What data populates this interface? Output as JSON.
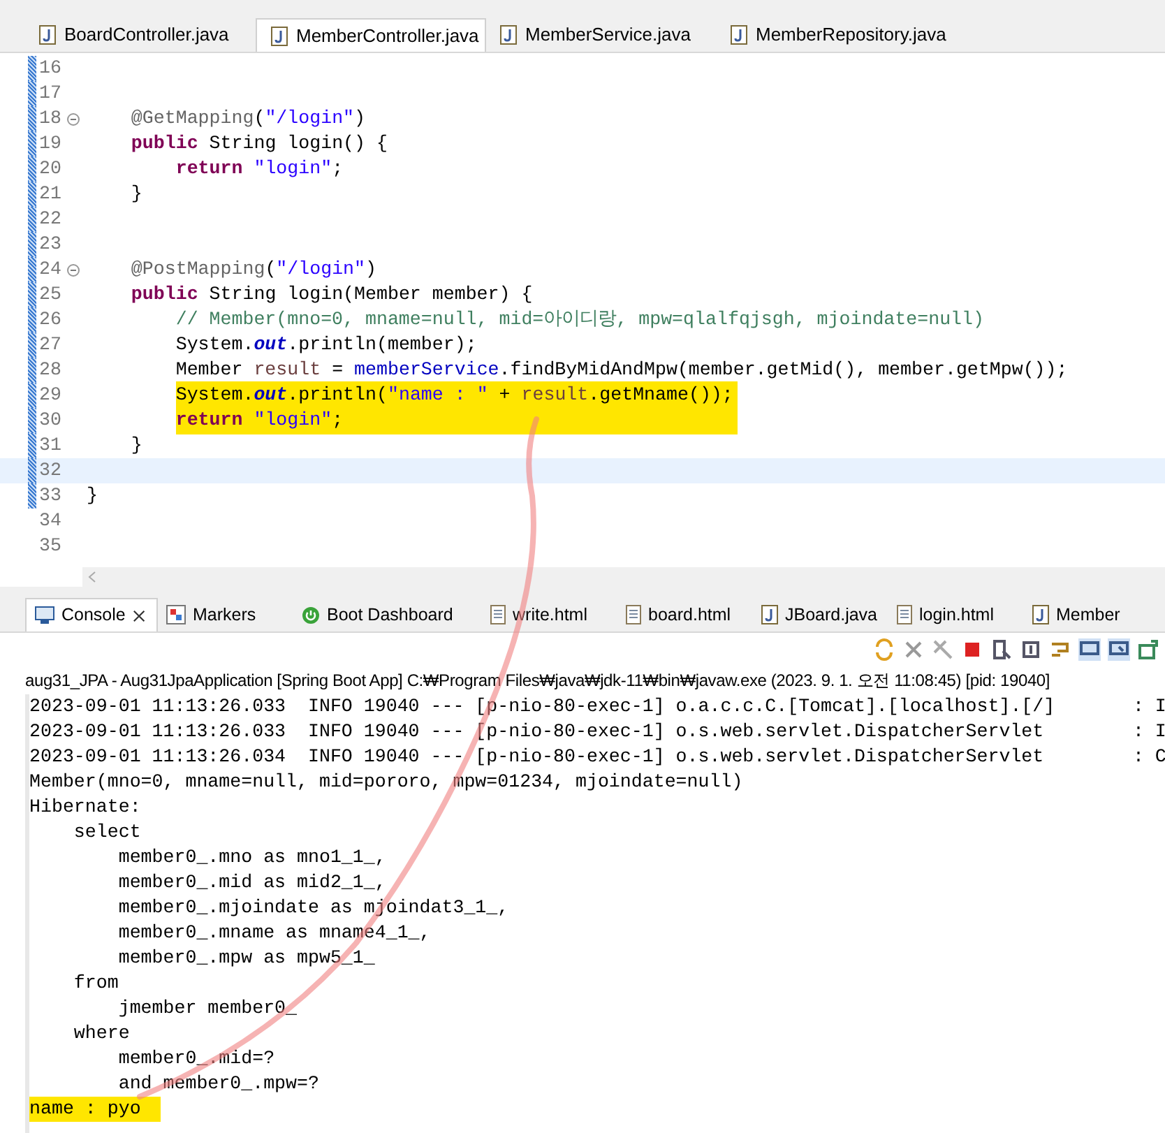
{
  "editor_tabs": [
    {
      "label": "BoardController.java",
      "selected": false
    },
    {
      "label": "MemberController.java",
      "selected": true
    },
    {
      "label": "MemberService.java",
      "selected": false
    },
    {
      "label": "MemberRepository.java",
      "selected": false
    }
  ],
  "code_lines": [
    {
      "number": "16",
      "folding": false,
      "changed": true,
      "current": false
    },
    {
      "number": "17",
      "folding": false,
      "changed": true,
      "current": false
    },
    {
      "number": "18",
      "folding": true,
      "changed": true,
      "current": false,
      "highlighted": false,
      "tokens": [
        {
          "kind": "ann",
          "text": "    @GetMapping"
        },
        {
          "kind": "plain",
          "text": "("
        },
        {
          "kind": "str",
          "text": "\"/login\""
        },
        {
          "kind": "plain",
          "text": ")"
        }
      ]
    },
    {
      "number": "19",
      "folding": false,
      "changed": true,
      "current": false,
      "highlighted": false,
      "tokens": [
        {
          "kind": "kw",
          "text": "    public"
        },
        {
          "kind": "plain",
          "text": " String login() {"
        }
      ]
    },
    {
      "number": "20",
      "folding": false,
      "changed": true,
      "current": false,
      "highlighted": false,
      "tokens": [
        {
          "kind": "kw",
          "text": "        return"
        },
        {
          "kind": "str",
          "text": " \"login\""
        },
        {
          "kind": "plain",
          "text": ";"
        }
      ]
    },
    {
      "number": "21",
      "folding": false,
      "changed": true,
      "current": false,
      "highlighted": false,
      "tokens": [
        {
          "kind": "plain",
          "text": "    }"
        }
      ]
    },
    {
      "number": "22",
      "folding": false,
      "changed": true,
      "current": false
    },
    {
      "number": "23",
      "folding": false,
      "changed": true,
      "current": false
    },
    {
      "number": "24",
      "folding": true,
      "changed": true,
      "current": false,
      "highlighted": false,
      "tokens": [
        {
          "kind": "ann",
          "text": "    @PostMapping"
        },
        {
          "kind": "plain",
          "text": "("
        },
        {
          "kind": "str",
          "text": "\"/login\""
        },
        {
          "kind": "plain",
          "text": ")"
        }
      ]
    },
    {
      "number": "25",
      "folding": false,
      "changed": true,
      "current": false,
      "highlighted": false,
      "tokens": [
        {
          "kind": "kw",
          "text": "    public"
        },
        {
          "kind": "plain",
          "text": " String login(Member member) {"
        }
      ]
    },
    {
      "number": "26",
      "folding": false,
      "changed": true,
      "current": false,
      "highlighted": false,
      "tokens": [
        {
          "kind": "cmt",
          "text": "        // Member(mno=0, mname=null, mid=아이디랑, mpw=qlalfqjsgh, mjoindate=null)"
        }
      ]
    },
    {
      "number": "27",
      "folding": false,
      "changed": true,
      "current": false,
      "highlighted": false,
      "tokens": [
        {
          "kind": "plain",
          "text": "        System."
        },
        {
          "kind": "out",
          "text": "out"
        },
        {
          "kind": "plain",
          "text": ".println(member);"
        }
      ]
    },
    {
      "number": "28",
      "folding": false,
      "changed": true,
      "current": false,
      "highlighted": false,
      "tokens": [
        {
          "kind": "plain",
          "text": "        Member "
        },
        {
          "kind": "var",
          "text": "result"
        },
        {
          "kind": "plain",
          "text": " = "
        },
        {
          "kind": "fld",
          "text": "memberService"
        },
        {
          "kind": "plain",
          "text": ".findByMidAndMpw(member.getMid(), member.getMpw());"
        }
      ]
    },
    {
      "number": "29",
      "folding": false,
      "changed": true,
      "current": false,
      "highlighted": true,
      "tokens": [
        {
          "kind": "plain",
          "text": "        System."
        },
        {
          "kind": "out",
          "text": "out"
        },
        {
          "kind": "plain",
          "text": ".println("
        },
        {
          "kind": "str",
          "text": "\"name : \""
        },
        {
          "kind": "plain",
          "text": " + "
        },
        {
          "kind": "var",
          "text": "result"
        },
        {
          "kind": "plain",
          "text": ".getMname());"
        }
      ]
    },
    {
      "number": "30",
      "folding": false,
      "changed": true,
      "current": false,
      "highlighted": true,
      "tokens": [
        {
          "kind": "kw",
          "text": "        return"
        },
        {
          "kind": "str",
          "text": " \"login\""
        },
        {
          "kind": "plain",
          "text": ";"
        }
      ]
    },
    {
      "number": "31",
      "folding": false,
      "changed": true,
      "current": false,
      "highlighted": false,
      "tokens": [
        {
          "kind": "plain",
          "text": "    }"
        }
      ]
    },
    {
      "number": "32",
      "folding": false,
      "changed": true,
      "current": true
    },
    {
      "number": "33",
      "folding": false,
      "changed": true,
      "current": false,
      "highlighted": false,
      "tokens": [
        {
          "kind": "plain",
          "text": "}"
        }
      ]
    },
    {
      "number": "34",
      "folding": false,
      "changed": false,
      "current": false
    },
    {
      "number": "35",
      "folding": false,
      "changed": false,
      "current": false
    }
  ],
  "view_tabs": [
    {
      "label": "Console",
      "kind": "console",
      "selected": true
    },
    {
      "label": "Markers",
      "kind": "markers",
      "selected": false
    },
    {
      "label": "Boot Dashboard",
      "kind": "boot",
      "selected": false
    },
    {
      "label": "write.html",
      "kind": "html",
      "selected": false
    },
    {
      "label": "board.html",
      "kind": "html",
      "selected": false
    },
    {
      "label": "JBoard.java",
      "kind": "java",
      "selected": false
    },
    {
      "label": "login.html",
      "kind": "html",
      "selected": false
    },
    {
      "label": "Member",
      "kind": "java",
      "selected": false
    }
  ],
  "launch_info": "aug31_JPA - Aug31JpaApplication [Spring Boot App] C:₩Program Files₩java₩jdk-11₩bin₩javaw.exe  (2023. 9. 1. 오전 11:08:45) [pid: 19040]",
  "console_lines": [
    {
      "text": "2023-09-01 11:13:26.033  INFO 19040 --- [p-nio-80-exec-1] o.a.c.c.C.[Tomcat].[localhost].[/]       : I",
      "highlighted": false
    },
    {
      "text": "2023-09-01 11:13:26.033  INFO 19040 --- [p-nio-80-exec-1] o.s.web.servlet.DispatcherServlet        : I",
      "highlighted": false
    },
    {
      "text": "2023-09-01 11:13:26.034  INFO 19040 --- [p-nio-80-exec-1] o.s.web.servlet.DispatcherServlet        : C",
      "highlighted": false
    },
    {
      "text": "Member(mno=0, mname=null, mid=pororo, mpw=01234, mjoindate=null)",
      "highlighted": false
    },
    {
      "text": "Hibernate: ",
      "highlighted": false
    },
    {
      "text": "    select",
      "highlighted": false
    },
    {
      "text": "        member0_.mno as mno1_1_,",
      "highlighted": false
    },
    {
      "text": "        member0_.mid as mid2_1_,",
      "highlighted": false
    },
    {
      "text": "        member0_.mjoindate as mjoindat3_1_,",
      "highlighted": false
    },
    {
      "text": "        member0_.mname as mname4_1_,",
      "highlighted": false
    },
    {
      "text": "        member0_.mpw as mpw5_1_ ",
      "highlighted": false
    },
    {
      "text": "    from",
      "highlighted": false
    },
    {
      "text": "        jmember member0_ ",
      "highlighted": false
    },
    {
      "text": "    where",
      "highlighted": false
    },
    {
      "text": "        member0_.mid=? ",
      "highlighted": false
    },
    {
      "text": "        and member0_.mpw=?",
      "highlighted": false
    },
    {
      "text": "name : pyo",
      "highlighted": true
    }
  ]
}
